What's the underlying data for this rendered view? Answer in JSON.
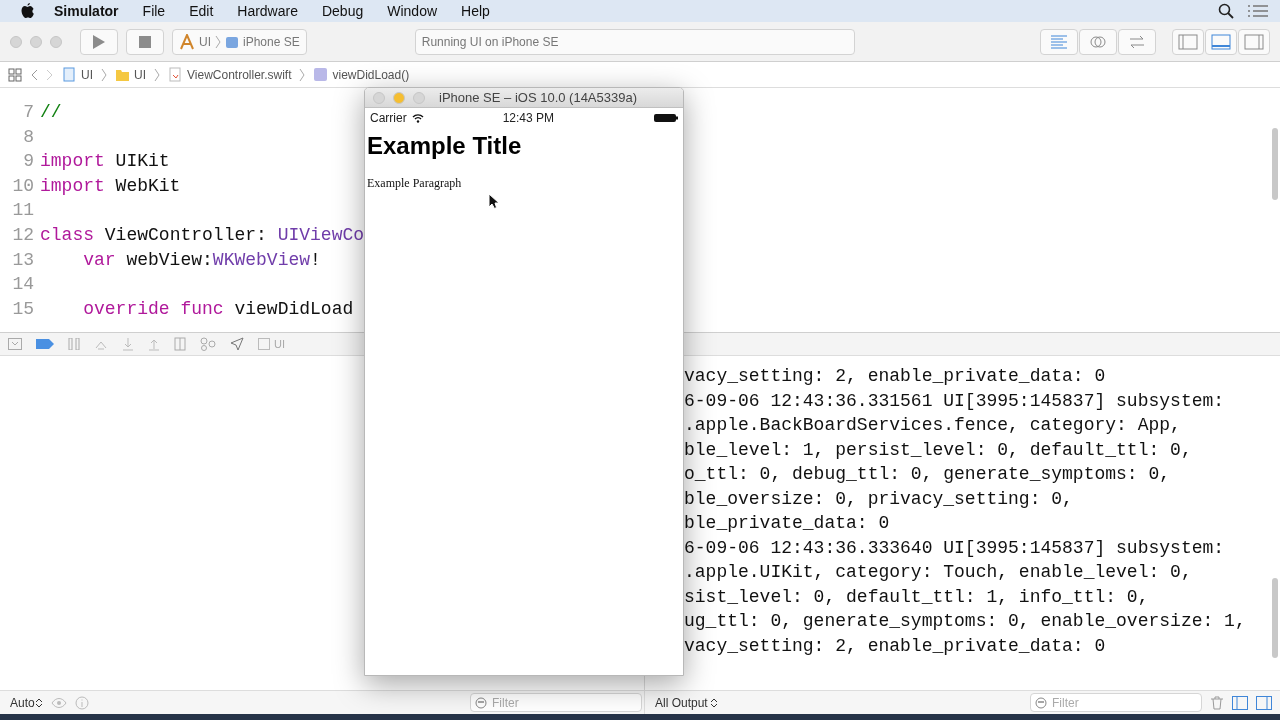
{
  "menu_bar": {
    "app": "Simulator",
    "items": [
      "File",
      "Edit",
      "Hardware",
      "Debug",
      "Window",
      "Help"
    ]
  },
  "toolbar": {
    "scheme": {
      "target": "UI",
      "device": "iPhone SE"
    },
    "activity": "Running UI on iPhone SE",
    "editor_modes": [
      {
        "selected": true
      },
      {
        "selected": false
      },
      {
        "selected": false
      }
    ],
    "panel_toggles": [
      {
        "selected": false
      },
      {
        "selected": true
      },
      {
        "selected": false
      }
    ]
  },
  "jump_bar": [
    "UI",
    "UI",
    "ViewController.swift",
    "viewDidLoad()"
  ],
  "editor": {
    "lines": [
      {
        "number": "7",
        "tokens": [
          {
            "kind": "comment",
            "text": "//"
          }
        ]
      },
      {
        "number": "8"
      },
      {
        "number": "9",
        "tokens": [
          {
            "kind": "keyword",
            "text": "import"
          },
          {
            "kind": "plain",
            "text": " UIKit"
          }
        ]
      },
      {
        "number": "10",
        "tokens": [
          {
            "kind": "keyword",
            "text": "import"
          },
          {
            "kind": "plain",
            "text": " WebKit"
          }
        ]
      },
      {
        "number": "11"
      },
      {
        "number": "12",
        "tokens": [
          {
            "kind": "keyword",
            "text": "class"
          },
          {
            "kind": "plain",
            "text": " ViewController: "
          },
          {
            "kind": "type",
            "text": "UIViewCo"
          }
        ],
        "children": [
          {
            "number": "13",
            "tokens": [
              {
                "kind": "keyword",
                "text": "var"
              },
              {
                "kind": "plain",
                "text": " webView:"
              },
              {
                "kind": "type",
                "text": "WKWebView"
              },
              {
                "kind": "plain",
                "text": "!"
              }
            ]
          },
          {
            "number": "14"
          },
          {
            "number": "15",
            "tokens": [
              {
                "kind": "keyword",
                "text": "override func"
              },
              {
                "kind": "plain",
                "text": " viewDidLoad"
              }
            ]
          }
        ]
      }
    ]
  },
  "debug_bar": {
    "breakpoints_active": true,
    "process": "UI"
  },
  "console": {
    "lines": [
      "vacy_setting: 2, enable_private_data: 0",
      "6-09-06 12:43:36.331561 UI[3995:145837] subsystem:",
      ".apple.BackBoardServices.fence, category: App,",
      "ble_level: 1, persist_level: 0, default_ttl: 0,",
      "o_ttl: 0, debug_ttl: 0, generate_symptoms: 0,",
      "ble_oversize: 0, privacy_setting: 0,",
      "ble_private_data: 0",
      "6-09-06 12:43:36.333640 UI[3995:145837] subsystem:",
      ".apple.UIKit, category: Touch, enable_level: 0,",
      "sist_level: 0, default_ttl: 1, info_ttl: 0,",
      "ug_ttl: 0, generate_symptoms: 0, enable_oversize: 1,",
      "vacy_setting: 2, enable_private_data: 0"
    ]
  },
  "bottom_bar": {
    "variables_mode": "Auto",
    "variables_filter": {
      "placeholder": "Filter"
    },
    "output_mode": "All Output",
    "console_filter": {
      "placeholder": "Filter"
    },
    "console_toggles": [
      {
        "selected": true
      },
      {
        "selected": true
      }
    ]
  },
  "simulator": {
    "title": "iPhone SE – iOS 10.0 (14A5339a)",
    "status_bar": {
      "carrier": "Carrier",
      "time": "12:43 PM"
    },
    "page": {
      "title": "Example Title",
      "paragraph": "Example Paragraph"
    }
  }
}
